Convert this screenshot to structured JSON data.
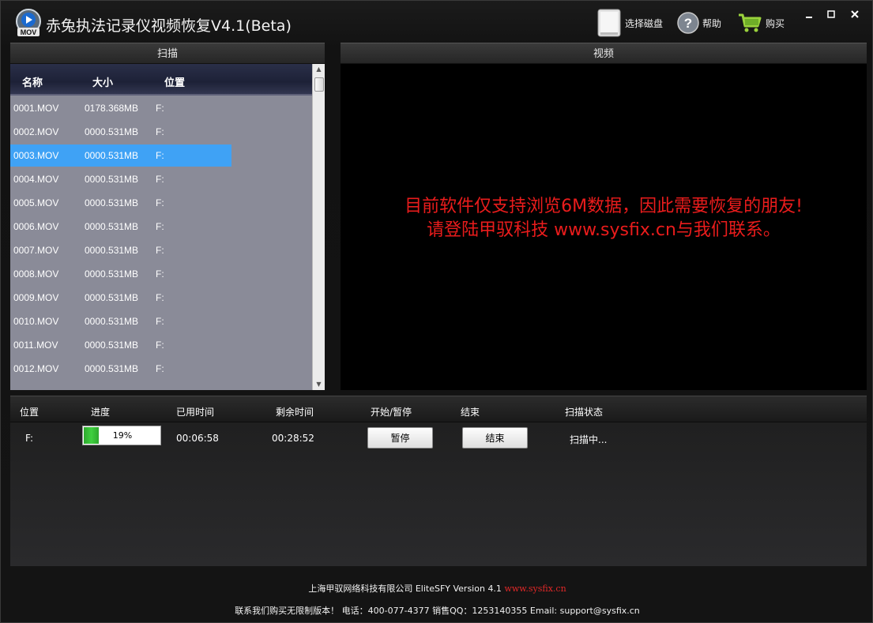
{
  "window": {
    "title": "赤兔执法记录仪视频恢复V4.1(Beta)",
    "logo_text": "MOV"
  },
  "toolbar": {
    "select_disk": "选择磁盘",
    "help": "帮助",
    "buy": "购买"
  },
  "scan": {
    "title": "扫描",
    "columns": {
      "name": "名称",
      "size": "大小",
      "location": "位置"
    },
    "files": [
      {
        "name": "0001.MOV",
        "size": "0178.368MB",
        "location": "F:",
        "selected": false
      },
      {
        "name": "0002.MOV",
        "size": "0000.531MB",
        "location": "F:",
        "selected": false
      },
      {
        "name": "0003.MOV",
        "size": "0000.531MB",
        "location": "F:",
        "selected": true
      },
      {
        "name": "0004.MOV",
        "size": "0000.531MB",
        "location": "F:",
        "selected": false
      },
      {
        "name": "0005.MOV",
        "size": "0000.531MB",
        "location": "F:",
        "selected": false
      },
      {
        "name": "0006.MOV",
        "size": "0000.531MB",
        "location": "F:",
        "selected": false
      },
      {
        "name": "0007.MOV",
        "size": "0000.531MB",
        "location": "F:",
        "selected": false
      },
      {
        "name": "0008.MOV",
        "size": "0000.531MB",
        "location": "F:",
        "selected": false
      },
      {
        "name": "0009.MOV",
        "size": "0000.531MB",
        "location": "F:",
        "selected": false
      },
      {
        "name": "0010.MOV",
        "size": "0000.531MB",
        "location": "F:",
        "selected": false
      },
      {
        "name": "0011.MOV",
        "size": "0000.531MB",
        "location": "F:",
        "selected": false
      },
      {
        "name": "0012.MOV",
        "size": "0000.531MB",
        "location": "F:",
        "selected": false
      }
    ]
  },
  "video": {
    "title": "视频",
    "message_line1": "目前软件仅支持浏览6M数据，因此需要恢复的朋友!",
    "message_line2": "请登陆甲驭科技 www.sysfix.cn与我们联系。",
    "message_color": "#ea1c1c"
  },
  "progress": {
    "headers": {
      "location": "位置",
      "progress": "进度",
      "elapsed": "已用时间",
      "remaining": "剩余时间",
      "start_pause": "开始/暂停",
      "end": "结束",
      "status": "扫描状态"
    },
    "location": "F:",
    "percent_text": "19%",
    "percent_value": 0.19,
    "elapsed": "00:06:58",
    "remaining": "00:28:52",
    "pause_button": "暂停",
    "end_button": "结束",
    "status": "扫描中..."
  },
  "footer": {
    "company": "上海甲驭网络科技有限公司 EliteSFY Version 4.1",
    "website": "www.sysfix.cn",
    "contact": "联系我们购买无限制版本！ 电话：400-077-4377 销售QQ：1253140355 Email: support@sysfix.cn"
  }
}
